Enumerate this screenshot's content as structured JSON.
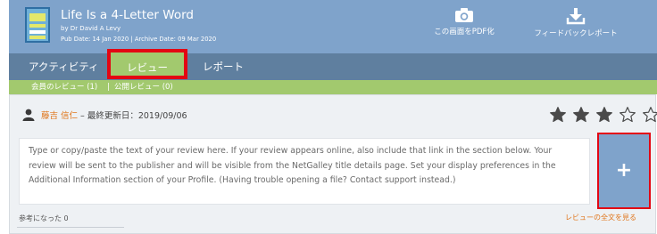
{
  "book": {
    "title": "Life Is a 4-Letter Word",
    "author": "by Dr David A Levy",
    "dates": "Pub Date: 14 Jan 2020   |   Archive Date: 09 Mar 2020"
  },
  "actions": {
    "pdf_label": "この画面をPDF化",
    "pdf_icon": "camera-icon",
    "feedback_label": "フィードバックレポート",
    "feedback_icon": "download-icon"
  },
  "tabs": [
    {
      "label": "アクティビティ"
    },
    {
      "label": "レビュー",
      "active": true
    },
    {
      "label": "レポート"
    }
  ],
  "subtabs": {
    "member": "会員のレビュー (1)",
    "separator": "|",
    "public": "公開レビュー (0)"
  },
  "review": {
    "reviewer_name": "藤吉 信仁",
    "updated": " – 最終更新日：2019/09/06",
    "rating": 3,
    "max_rating": 5,
    "body": "Type or copy/paste the text of your review here. If your review appears online, also include that link in the section below. Your review will be sent to the publisher and will be visible from the NetGalley title details page. Set your display preferences in the Additional Information section of your Profile. (Having trouble opening a file? Contact support instead.)",
    "add_label": "+",
    "helpful": "参考になった 0",
    "view_full": "レビューの全文を見る"
  },
  "colors": {
    "header": "#7fa3cb",
    "tabbar": "#5f7f9f",
    "active_tab": "#a2c96e",
    "highlight": "#e30613",
    "accent_orange": "#e0761d",
    "star": "#4a4a4a"
  }
}
